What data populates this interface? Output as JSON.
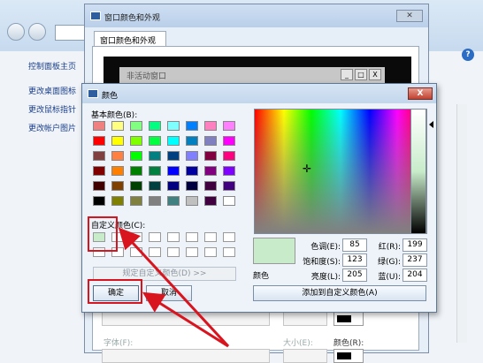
{
  "control_panel": {
    "side_links": [
      "控制面板主页",
      "更改桌面图标",
      "更改鼠标指针",
      "更改帐户图片"
    ],
    "help_icon": "?"
  },
  "appearance_window": {
    "title": "窗口颜色和外观",
    "close_label": "✕",
    "tab_label": "窗口颜色和外观",
    "inactive_window_title": "非活动窗口",
    "inactive_buttons": [
      "_",
      "□",
      "X"
    ],
    "font_label": "字体(F):",
    "size_label": "大小(E):",
    "color_label": "颜色(R):"
  },
  "color_dialog": {
    "title": "颜色",
    "close_label": "X",
    "basic_colors_label": "基本颜色(B):",
    "basic_colors": [
      "#f08080",
      "#ffff80",
      "#80ff80",
      "#00ff80",
      "#80ffff",
      "#0080ff",
      "#ff80c0",
      "#ff80ff",
      "#ff0000",
      "#ffff00",
      "#80ff00",
      "#00ff40",
      "#00ffff",
      "#0080c0",
      "#8080c0",
      "#ff00ff",
      "#804040",
      "#ff8040",
      "#00ff00",
      "#008080",
      "#004080",
      "#8080ff",
      "#800040",
      "#ff0080",
      "#800000",
      "#ff8000",
      "#008000",
      "#008040",
      "#0000ff",
      "#0000a0",
      "#800080",
      "#8000ff",
      "#400000",
      "#804000",
      "#004000",
      "#004040",
      "#000080",
      "#000040",
      "#400040",
      "#400080",
      "#000000",
      "#808000",
      "#808040",
      "#808080",
      "#408080",
      "#c0c0c0",
      "#400040",
      "#ffffff"
    ],
    "custom_colors_label": "自定义颜色(C):",
    "custom_colors": [
      "#c8ecca",
      "#ffffff",
      "#ffffff",
      "#ffffff",
      "#ffffff",
      "#ffffff",
      "#ffffff",
      "#ffffff",
      "#ffffff",
      "#ffffff",
      "#ffffff",
      "#ffffff",
      "#ffffff",
      "#ffffff",
      "#ffffff",
      "#ffffff"
    ],
    "define_custom_label": "规定自定义颜色(D) >>",
    "ok_label": "确定",
    "cancel_label": "取消",
    "sample_label": "颜色",
    "sample_color": "#c8ecca",
    "hue_label": "色调(E):",
    "hue": "85",
    "sat_label": "饱和度(S):",
    "sat": "123",
    "lum_label": "亮度(L):",
    "lum": "205",
    "red_label": "红(R):",
    "red": "199",
    "green_label": "绿(G):",
    "green": "237",
    "blue_label": "蓝(U):",
    "blue": "204",
    "add_custom_label": "添加到自定义颜色(A)"
  },
  "annotation_color": "#d8141e"
}
